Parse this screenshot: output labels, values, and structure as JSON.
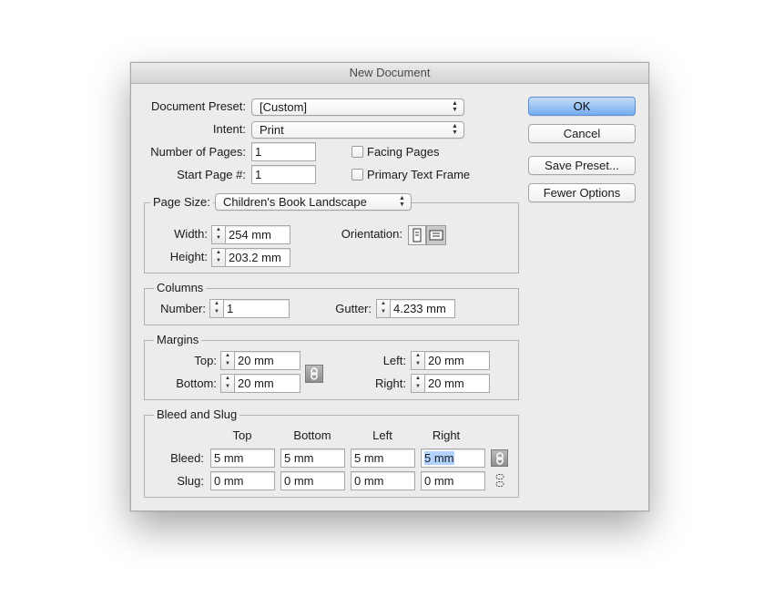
{
  "window": {
    "title": "New Document"
  },
  "preset": {
    "label": "Document Preset:",
    "value": "[Custom]"
  },
  "intent": {
    "label": "Intent:",
    "value": "Print"
  },
  "pages": {
    "count_label": "Number of Pages:",
    "count_value": "1",
    "start_label": "Start Page #:",
    "start_value": "1",
    "facing_label": "Facing Pages",
    "primary_label": "Primary Text Frame"
  },
  "page_size": {
    "label": "Page Size:",
    "value": "Children's Book Landscape",
    "width_label": "Width:",
    "width_value": "254 mm",
    "height_label": "Height:",
    "height_value": "203.2 mm",
    "orientation_label": "Orientation:"
  },
  "columns": {
    "title": "Columns",
    "number_label": "Number:",
    "number_value": "1",
    "gutter_label": "Gutter:",
    "gutter_value": "4.233 mm"
  },
  "margins": {
    "title": "Margins",
    "top_label": "Top:",
    "top_value": "20 mm",
    "bottom_label": "Bottom:",
    "bottom_value": "20 mm",
    "left_label": "Left:",
    "left_value": "20 mm",
    "right_label": "Right:",
    "right_value": "20 mm"
  },
  "bleed_slug": {
    "title": "Bleed and Slug",
    "headers": [
      "Top",
      "Bottom",
      "Left",
      "Right"
    ],
    "bleed_label": "Bleed:",
    "bleed_values": [
      "5 mm",
      "5 mm",
      "5 mm",
      "5 mm"
    ],
    "slug_label": "Slug:",
    "slug_values": [
      "0 mm",
      "0 mm",
      "0 mm",
      "0 mm"
    ]
  },
  "buttons": {
    "ok": "OK",
    "cancel": "Cancel",
    "save_preset": "Save Preset...",
    "fewer_options": "Fewer Options"
  },
  "colors": {
    "default_button": "#75acf0",
    "selection": "#b3d3ff"
  }
}
